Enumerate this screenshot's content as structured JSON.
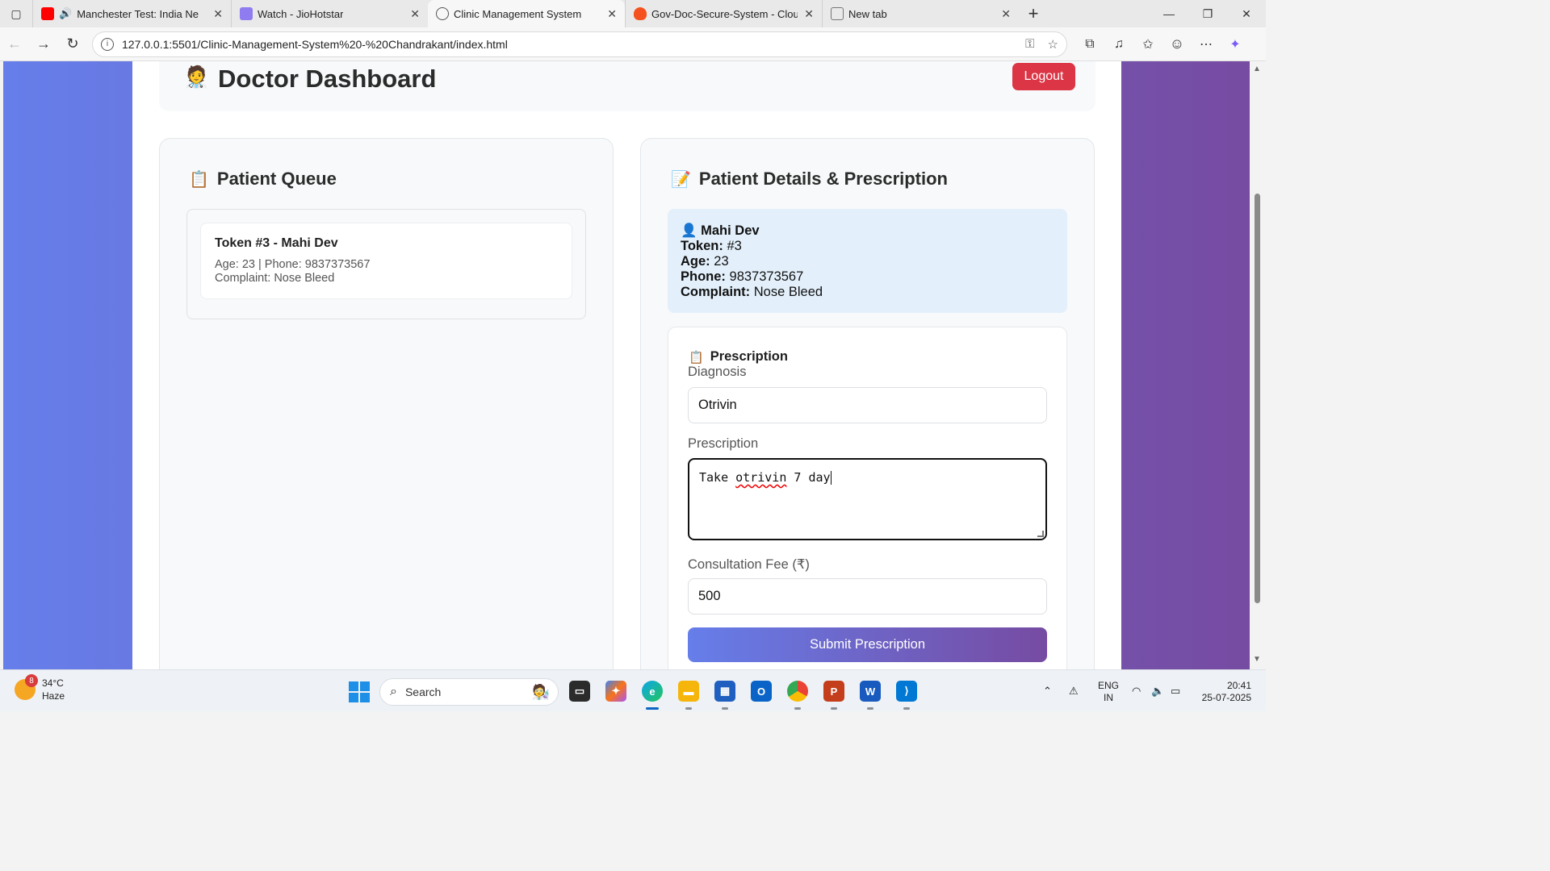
{
  "browser": {
    "tabs": [
      {
        "label": "Manchester Test: India Ne",
        "favicon_color": "#ff0000",
        "active": false
      },
      {
        "label": "Watch - JioHotstar",
        "favicon_color": "#8e7cf0",
        "active": false
      },
      {
        "label": "Clinic Management System",
        "favicon_color": "#555555",
        "active": true
      },
      {
        "label": "Gov-Doc-Secure-System - Cloud I",
        "favicon_color": "#f4511e",
        "active": false
      },
      {
        "label": "New tab",
        "favicon_color": "#777777",
        "active": false
      }
    ],
    "url": "127.0.0.1:5501/Clinic-Management-System%20-%20Chandrakant/index.html"
  },
  "header": {
    "title": "Doctor Dashboard",
    "logout_label": "Logout"
  },
  "queue": {
    "title": "Patient Queue",
    "items": [
      {
        "title": "Token #3 - Mahi Dev",
        "line1": "Age: 23 | Phone: 9837373567",
        "line2": "Complaint: Nose Bleed"
      }
    ]
  },
  "details": {
    "title": "Patient Details & Prescription",
    "patient_name": "Mahi Dev",
    "token_label": "Token:",
    "token_value": "#3",
    "age_label": "Age:",
    "age_value": "23",
    "phone_label": "Phone:",
    "phone_value": "9837373567",
    "complaint_label": "Complaint:",
    "complaint_value": "Nose Bleed"
  },
  "prescription": {
    "title": "Prescription",
    "diagnosis_label": "Diagnosis",
    "diagnosis_value": "Otrivin",
    "prescription_label": "Prescription",
    "prescription_word1": "Take ",
    "prescription_misspelled": "otrivin",
    "prescription_rest": " 7 day",
    "fee_label": "Consultation Fee (₹)",
    "fee_value": "500",
    "submit_label": "Submit Prescription"
  },
  "taskbar": {
    "weather_badge": "8",
    "temperature": "34°C",
    "condition": "Haze",
    "search_label": "Search",
    "lang_line1": "ENG",
    "lang_line2": "IN",
    "time": "20:41",
    "date": "25-07-2025"
  },
  "colors": {
    "gradient_start": "#667eea",
    "gradient_end": "#764ba2",
    "logout": "#dc3545",
    "patient_box": "#e3f0fb"
  }
}
